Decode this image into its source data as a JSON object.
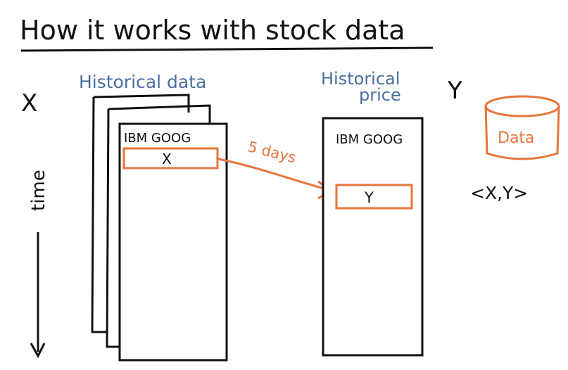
{
  "title": "How it works with stock data",
  "left_panel": {
    "label": "Historical data",
    "axis_x_label": "X",
    "time_label": "time",
    "tickers": "IBM GOOG",
    "feature_cell": "X"
  },
  "arrow_label": "5 days",
  "right_panel": {
    "label_line1": "Historical",
    "label_line2": "price",
    "axis_y_label": "Y",
    "tickers": "IBM GOOG",
    "target_cell": "Y"
  },
  "database": {
    "label": "Data",
    "pair": "<X,Y>"
  },
  "colors": {
    "ink": "#111111",
    "blue": "#4a6ea3",
    "orange": "#e8743b"
  }
}
